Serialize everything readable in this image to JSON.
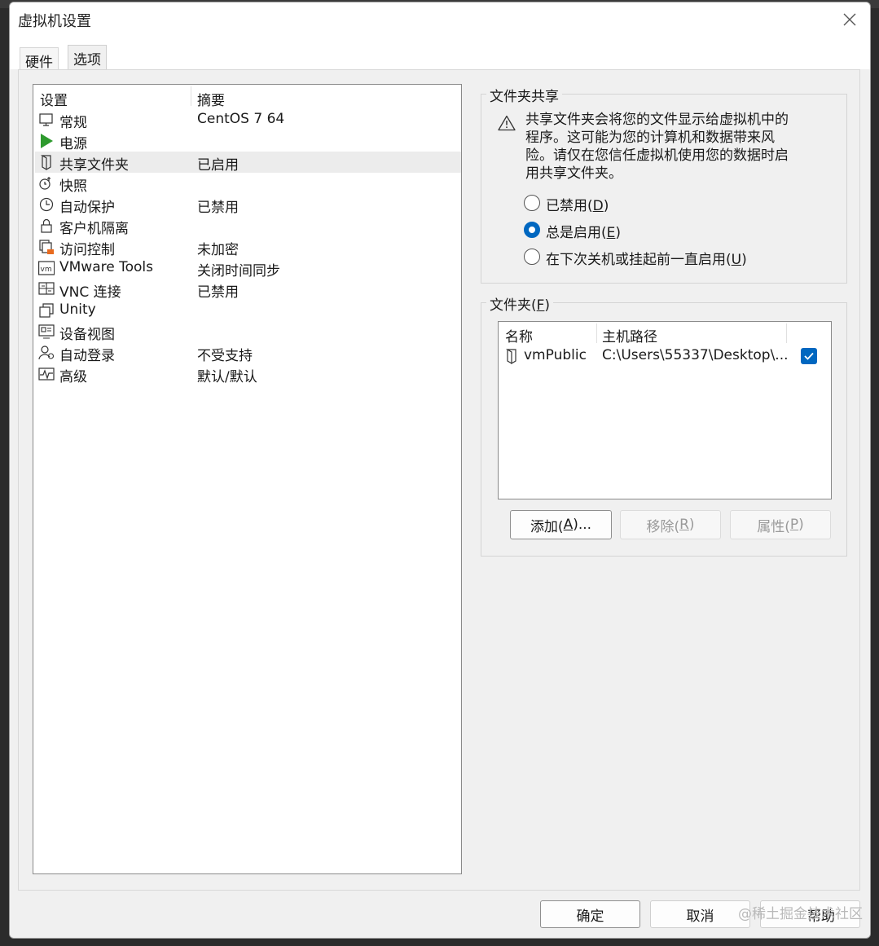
{
  "window": {
    "title": "虚拟机设置"
  },
  "tabs": [
    {
      "label": "硬件"
    },
    {
      "label": "选项"
    }
  ],
  "settings_list": {
    "headers": {
      "setting": "设置",
      "summary": "摘要"
    },
    "items": [
      {
        "name": "常规",
        "summary": "CentOS 7 64",
        "icon": "monitor-icon"
      },
      {
        "name": "电源",
        "summary": "",
        "icon": "power-play-icon"
      },
      {
        "name": "共享文件夹",
        "summary": "已启用",
        "icon": "shared-folder-icon"
      },
      {
        "name": "快照",
        "summary": "",
        "icon": "snapshot-icon"
      },
      {
        "name": "自动保护",
        "summary": "已禁用",
        "icon": "clock-icon"
      },
      {
        "name": "客户机隔离",
        "summary": "",
        "icon": "lock-icon"
      },
      {
        "name": "访问控制",
        "summary": "未加密",
        "icon": "access-control-icon"
      },
      {
        "name": "VMware Tools",
        "summary": "关闭时间同步",
        "icon": "vm-tools-icon"
      },
      {
        "name": "VNC 连接",
        "summary": "已禁用",
        "icon": "vnc-icon"
      },
      {
        "name": "Unity",
        "summary": "",
        "icon": "unity-icon"
      },
      {
        "name": "设备视图",
        "summary": "",
        "icon": "device-view-icon"
      },
      {
        "name": "自动登录",
        "summary": "不受支持",
        "icon": "autologin-icon"
      },
      {
        "name": "高级",
        "summary": "默认/默认",
        "icon": "advanced-icon"
      }
    ]
  },
  "folder_sharing": {
    "group_label": "文件夹共享",
    "warning": "共享文件夹会将您的文件显示给虚拟机中的程序。这可能为您的计算机和数据带来风险。请仅在您信任虚拟机使用您的数据时启用共享文件夹。",
    "options": [
      {
        "label": "已禁用(",
        "key": "D",
        "suffix": ")"
      },
      {
        "label": "总是启用(",
        "key": "E",
        "suffix": ")"
      },
      {
        "label": "在下次关机或挂起前一直启用(",
        "key": "U",
        "suffix": ")"
      }
    ],
    "selected_index": 1
  },
  "folders": {
    "group_label": "文件夹(",
    "group_key": "F",
    "group_suffix": ")",
    "headers": {
      "name": "名称",
      "host_path": "主机路径"
    },
    "rows": [
      {
        "name": "vmPublic",
        "host_path": "C:\\Users\\55337\\Desktop\\...",
        "enabled": true
      }
    ],
    "buttons": {
      "add": {
        "label": "添加(",
        "key": "A",
        "suffix": ")..."
      },
      "remove": {
        "label": "移除(",
        "key": "R",
        "suffix": ")"
      },
      "properties": {
        "label": "属性(",
        "key": "P",
        "suffix": ")"
      }
    }
  },
  "footer": {
    "ok": "确定",
    "cancel": "取消",
    "help": "帮助"
  },
  "watermark": "@稀土掘金技术社区",
  "colors": {
    "accent": "#0067c0",
    "power_green": "#2e9a2e",
    "lock_orange": "#e86b1f"
  }
}
